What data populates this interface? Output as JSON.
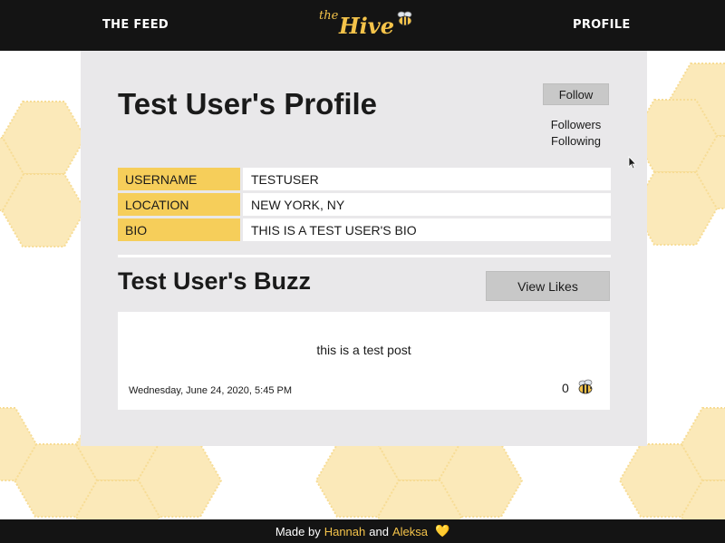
{
  "nav": {
    "feed_label": "THE FEED",
    "profile_label": "PROFILE",
    "logo_prefix": "the",
    "logo_name": "Hive"
  },
  "profile": {
    "title": "Test User's Profile",
    "follow_label": "Follow",
    "followers_label": "Followers",
    "following_label": "Following",
    "info": [
      {
        "key": "USERNAME",
        "value": "TESTUSER"
      },
      {
        "key": "LOCATION",
        "value": "NEW YORK, NY"
      },
      {
        "key": "BIO",
        "value": "THIS IS A TEST USER'S BIO"
      }
    ]
  },
  "buzz": {
    "title": "Test User's Buzz",
    "view_likes_label": "View Likes",
    "posts": [
      {
        "text": "this is a test post",
        "date": "Wednesday, June 24, 2020, 5:45 PM",
        "likes": "0",
        "like_icon": "bee-icon"
      }
    ]
  },
  "footer": {
    "made_by": "Made by",
    "author1": "Hannah",
    "and": "and",
    "author2": "Aleksa",
    "heart": "💛"
  },
  "colors": {
    "header_bg": "#141414",
    "accent": "#f4c34a",
    "label_bg": "#f6ce5a",
    "card_bg": "#e9e8ea",
    "comb_fill": "#fbe9b9"
  }
}
